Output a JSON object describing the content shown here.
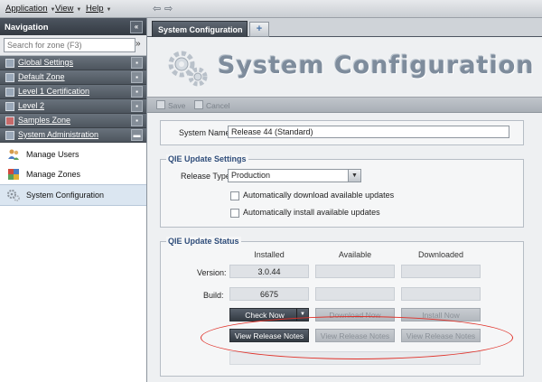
{
  "menubar": {
    "items": [
      {
        "label": "Application"
      },
      {
        "label": "View"
      },
      {
        "label": "Help"
      }
    ]
  },
  "navigation": {
    "title": "Navigation",
    "collapse_glyph": "«",
    "search": {
      "placeholder": "Search for zone (F3)",
      "go_glyph": "»"
    },
    "zones": [
      {
        "label": "Global Settings"
      },
      {
        "label": "Default Zone"
      },
      {
        "label": "Level 1 Certification"
      },
      {
        "label": "Level 2"
      },
      {
        "label": "Samples Zone"
      },
      {
        "label": "System Administration"
      }
    ],
    "expanded_items": [
      {
        "label": "Manage Users",
        "icon": "users-icon"
      },
      {
        "label": "Manage Zones",
        "icon": "zones-icon"
      },
      {
        "label": "System Configuration",
        "icon": "gears-icon"
      }
    ]
  },
  "tabs": {
    "active_label": "System Configuration",
    "add_glyph": "+"
  },
  "page": {
    "title": "System Configuration",
    "toolbar": {
      "save": "Save",
      "cancel": "Cancel"
    },
    "system_name": {
      "label": "System Name:",
      "value": "Release 44 (Standard)"
    },
    "update_settings": {
      "title": "QIE Update Settings",
      "release_type_label": "Release Type:",
      "release_type_value": "Production",
      "auto_download": "Automatically download available updates",
      "auto_install": "Automatically install available updates"
    },
    "update_status": {
      "title": "QIE Update Status",
      "columns": [
        "Installed",
        "Available",
        "Downloaded"
      ],
      "version_label": "Version:",
      "build_label": "Build:",
      "installed_version": "3.0.44",
      "installed_build": "6675",
      "check_now": "Check Now",
      "download_now": "Download Now",
      "install_now": "Install Now",
      "view_notes": "View Release Notes"
    }
  },
  "colors": {
    "annotation": "#e0322a",
    "accent": "#2f4d7a"
  }
}
